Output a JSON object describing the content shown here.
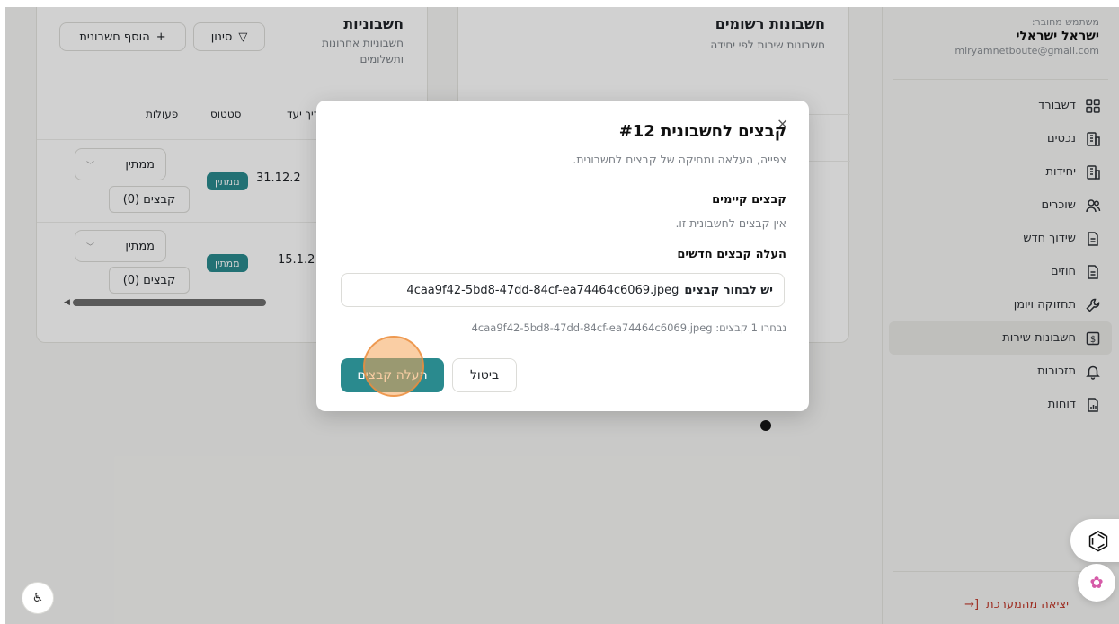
{
  "sidebar": {
    "user_caption": "משתמש מחובר:",
    "user_name": "ישראל ישראלי",
    "user_email": "miryamnetboute@gmail.com",
    "items": [
      {
        "label": "דשבורד",
        "icon": "dashboard-icon"
      },
      {
        "label": "נכסים",
        "icon": "building-icon"
      },
      {
        "label": "יחידות",
        "icon": "building-icon"
      },
      {
        "label": "שוכרים",
        "icon": "users-icon"
      },
      {
        "label": "שידוך חדש",
        "icon": "document-icon"
      },
      {
        "label": "חוזים",
        "icon": "document-icon"
      },
      {
        "label": "תחזוקה ויומן",
        "icon": "wrench-icon"
      },
      {
        "label": "חשבונות שירות",
        "icon": "dollar-icon",
        "active": true
      },
      {
        "label": "תזכורות",
        "icon": "bell-icon"
      },
      {
        "label": "דוחות",
        "icon": "report-icon"
      }
    ],
    "logout_label": "יציאה מהמערכת"
  },
  "registered_card": {
    "title": "חשבונות רשומים",
    "subtitle": "חשבונות שירות לפי יחידה"
  },
  "invoices_card": {
    "title": "חשבוניות",
    "subtitle": "חשבוניות אחרונות ותשלומים",
    "filter_label": "סינון",
    "add_label": "הוסף חשבונית",
    "columns": {
      "actions": "פעולות",
      "status": "סטטוס",
      "due": "ריך יעד"
    },
    "rows": [
      {
        "date": "31.12.2",
        "status": "ממתין",
        "dropdown": "ממתין",
        "files": "קבצים (0)"
      },
      {
        "date": "15.1.2",
        "status": "ממתין",
        "dropdown": "ממתין",
        "files": "קבצים (0)"
      }
    ]
  },
  "modal": {
    "title": "קבצים לחשבונית #12",
    "description": "צפייה, העלאה ומחיקה של קבצים לחשבונית.",
    "existing_title": "קבצים קיימים",
    "existing_text": "אין קבצים לחשבונית זו.",
    "upload_title": "העלה קבצים חדשים",
    "choose_label": "יש לבחור קבצים",
    "chosen_file": "4caa9f42-5bd8-47dd-84cf-ea74464c6069.jpeg",
    "summary": "נבחרו 1 קבצים: 4caa9f42-5bd8-47dd-84cf-ea74464c6069.jpeg",
    "cancel_label": "ביטול",
    "upload_label": "העלה קבצים",
    "close_symbol": "×"
  },
  "colors": {
    "accent": "#2a8a8e",
    "logout": "#c0392b"
  }
}
